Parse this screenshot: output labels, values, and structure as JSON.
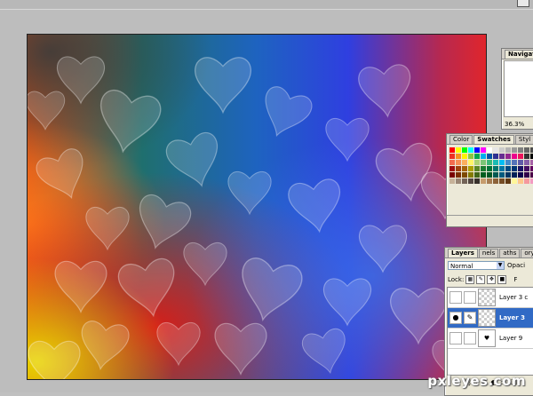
{
  "navigator": {
    "tab": "Navigat",
    "zoom": "36.3%"
  },
  "swatches_panel": {
    "tabs": [
      "Color",
      "Swatches",
      "Styl"
    ],
    "active_tab": "Swatches",
    "colors": [
      "#ff0000",
      "#ffff00",
      "#00ff00",
      "#00ffff",
      "#0000ff",
      "#ff00ff",
      "#ffffff",
      "#e6e6e6",
      "#cccccc",
      "#b3b3b3",
      "#999999",
      "#808080",
      "#666666",
      "#4d4d4d",
      "#ee3124",
      "#f7941d",
      "#fff200",
      "#8dc63f",
      "#00a651",
      "#00aeef",
      "#0054a6",
      "#2e3192",
      "#662d91",
      "#92278f",
      "#ec008c",
      "#ed145b",
      "#333333",
      "#000000",
      "#f26c4f",
      "#f68e56",
      "#fbaf5d",
      "#fff568",
      "#acd372",
      "#7cc576",
      "#3bb878",
      "#1abbb4",
      "#00bff3",
      "#438ccb",
      "#5574b9",
      "#605ca8",
      "#855fa8",
      "#a763a8",
      "#9e0b0f",
      "#a0410d",
      "#a3620a",
      "#aba000",
      "#598527",
      "#1a7b30",
      "#007236",
      "#00746b",
      "#0076a3",
      "#004a80",
      "#003471",
      "#1b1464",
      "#440e62",
      "#630460",
      "#790000",
      "#7b2e00",
      "#7d4900",
      "#827b00",
      "#406618",
      "#005e20",
      "#005826",
      "#005952",
      "#005b7f",
      "#003663",
      "#002157",
      "#0d004c",
      "#32004b",
      "#4b0049",
      "#c7b299",
      "#998675",
      "#736357",
      "#534741",
      "#37302a",
      "#c69c6d",
      "#a67c52",
      "#8c6239",
      "#754c24",
      "#603913",
      "#fff799",
      "#fdc689",
      "#f5989d",
      "#f49ac2"
    ]
  },
  "layers_panel": {
    "tabs": [
      "Layers",
      "nels",
      "aths",
      "ory"
    ],
    "active_tab": "Layers",
    "blend_mode": "Normal",
    "opacity_label": "Opaci",
    "lock_label": "Lock:",
    "fill_label": "F",
    "layers": [
      {
        "name": "Layer 3 c",
        "selected": false
      },
      {
        "name": "Layer 3",
        "selected": true
      },
      {
        "name": "Layer 9",
        "selected": false
      }
    ]
  },
  "watermark": "pxleyes.com"
}
